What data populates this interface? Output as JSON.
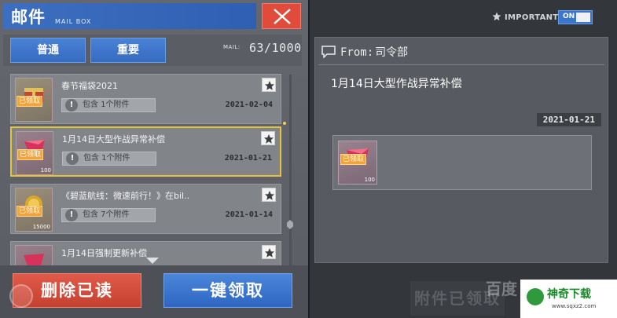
{
  "header": {
    "title": "邮件",
    "subtitle": "MAIL BOX"
  },
  "tabs": [
    {
      "label": "普通"
    },
    {
      "label": "重要"
    }
  ],
  "mail_counter": {
    "label": "MAIL:",
    "value": "63/1000"
  },
  "mails": [
    {
      "title": "春节福袋2021",
      "attachment_text": "包含 1个附件",
      "date": "2021-02-04",
      "tag": "已领取",
      "qty": ""
    },
    {
      "title": "1月14日大型作战异常补偿",
      "attachment_text": "包含 1个附件",
      "date": "2021-01-21",
      "tag": "已领取",
      "qty": "100"
    },
    {
      "title": "《碧蓝航线：微速前行！》在bil..",
      "attachment_text": "包含 7个附件",
      "date": "2021-01-14",
      "tag": "已领取",
      "qty": "15000"
    },
    {
      "title": "1月14日强制更新补偿",
      "attachment_text": "",
      "date": "",
      "tag": "",
      "qty": ""
    }
  ],
  "buttons": {
    "delete_read": "删除已读",
    "claim_all": "一键领取"
  },
  "important": {
    "label": "IMPORTANT",
    "toggle": "ON"
  },
  "detail": {
    "from_label": "From:",
    "from_value": "司令部",
    "message": "1月14日大型作战异常补偿",
    "date": "2021-01-21",
    "attachment": {
      "tag": "已领取",
      "qty": "100"
    },
    "claimed_button": "附件已领取"
  },
  "watermarks": {
    "baidu": "百度",
    "site_name": "神奇下载",
    "site_url": "www.sqxz2.com"
  },
  "colors": {
    "accent_blue": "#3a76cf",
    "danger_red": "#e14b3c",
    "selected_border": "#e7c33a",
    "claimed_tag": "#f2a43a"
  }
}
